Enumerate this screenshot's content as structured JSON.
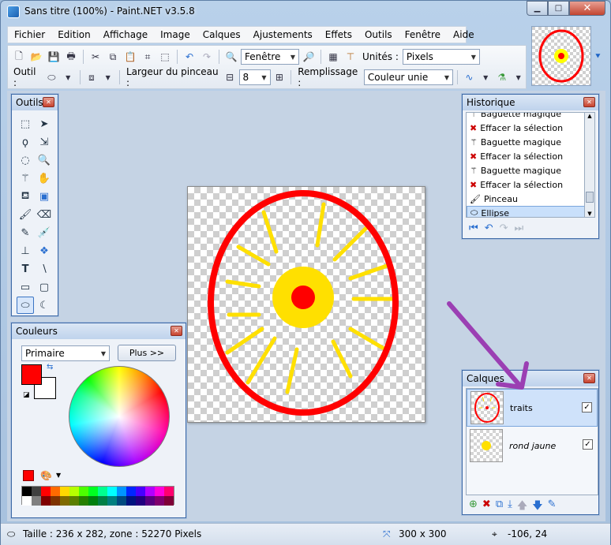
{
  "window": {
    "title": "Sans titre (100%) - Paint.NET v3.5.8",
    "accent": "#3e6aa7"
  },
  "menu": [
    "Fichier",
    "Edition",
    "Affichage",
    "Image",
    "Calques",
    "Ajustements",
    "Effets",
    "Outils",
    "Fenêtre",
    "Aide"
  ],
  "toolbar": {
    "zoom_value": "Fenêtre",
    "units_label": "Unités :",
    "units_value": "Pixels",
    "tool_label": "Outil :",
    "brush_width_label": "Largeur du pinceau :",
    "brush_width_value": "8",
    "fill_label": "Remplissage :",
    "fill_value": "Couleur unie"
  },
  "tools_panel": {
    "title": "Outils"
  },
  "history_panel": {
    "title": "Historique",
    "items": [
      {
        "label": "Baguette magique",
        "icon": "magic-wand-icon"
      },
      {
        "label": "Effacer la sélection",
        "icon": "delete-icon"
      },
      {
        "label": "Baguette magique",
        "icon": "magic-wand-icon"
      },
      {
        "label": "Effacer la sélection",
        "icon": "delete-icon"
      },
      {
        "label": "Baguette magique",
        "icon": "magic-wand-icon"
      },
      {
        "label": "Effacer la sélection",
        "icon": "delete-icon"
      },
      {
        "label": "Pinceau",
        "icon": "brush-icon"
      },
      {
        "label": "Ellipse",
        "icon": "ellipse-icon"
      }
    ]
  },
  "colors_panel": {
    "title": "Couleurs",
    "mode_value": "Primaire",
    "more_button": "Plus >>",
    "primary_color": "#ff0000",
    "secondary_color": "#ffffff"
  },
  "layers_panel": {
    "title": "Calques",
    "layers": [
      {
        "name": "traits",
        "visible": "✓"
      },
      {
        "name": "rond jaune",
        "visible": "✓"
      }
    ]
  },
  "status": {
    "selection": "Taille : 236 x 282, zone : 52270 Pixels",
    "image_size": "300 x 300",
    "cursor": "-106, 24"
  }
}
